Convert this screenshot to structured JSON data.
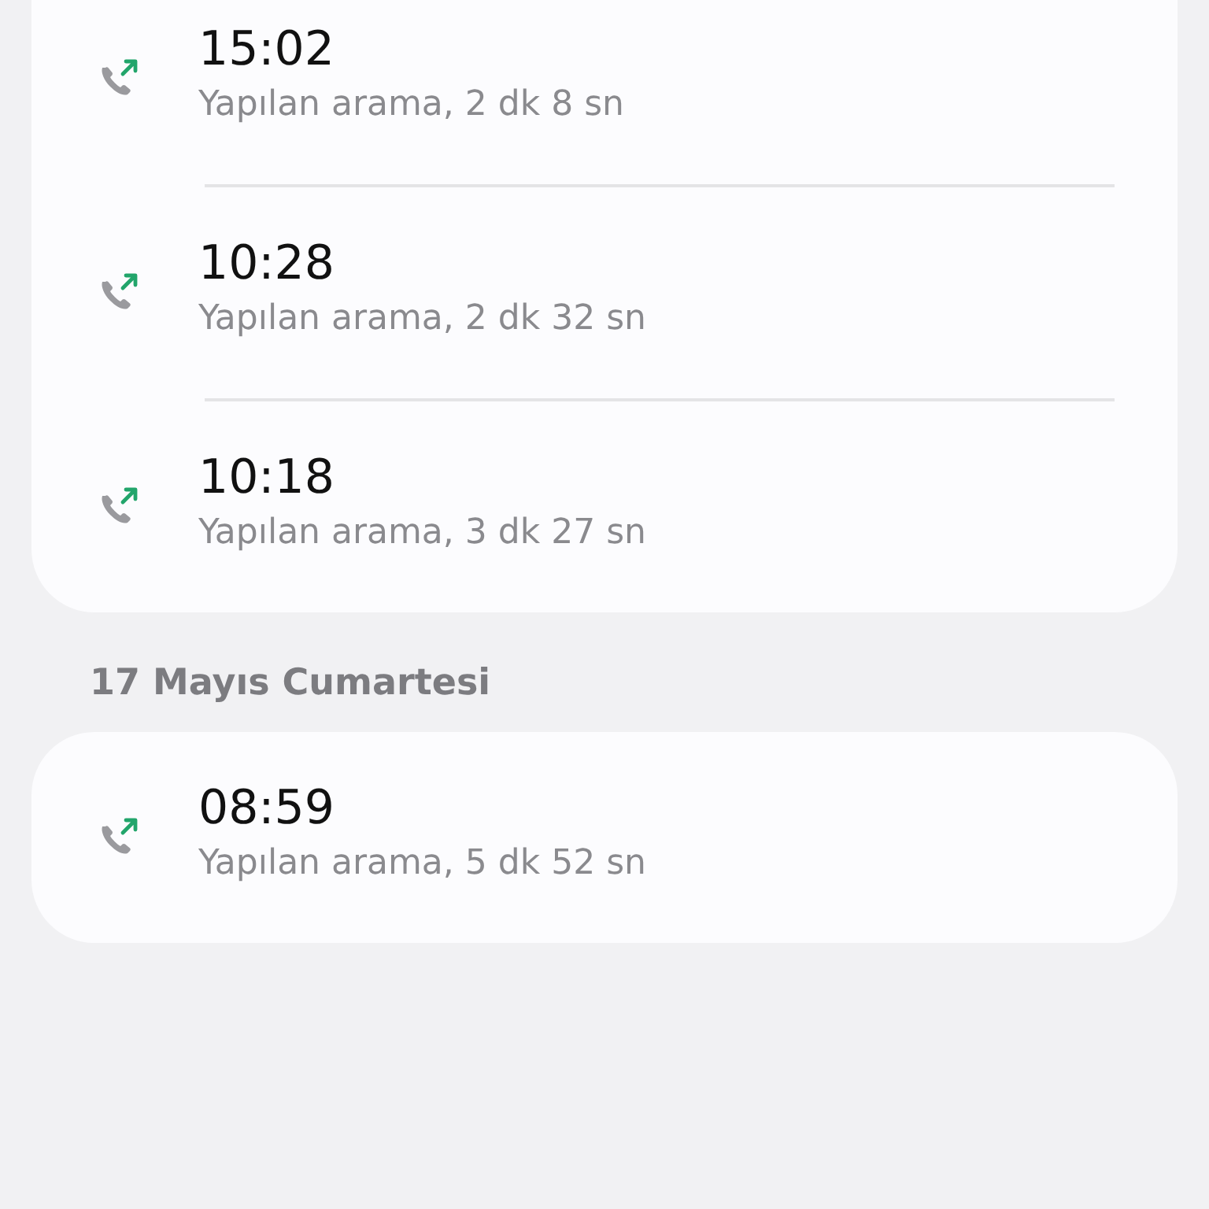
{
  "groups": [
    {
      "calls": [
        {
          "time": "15:02",
          "detail": "Yapılan arama, 2 dk 8 sn",
          "kind": "outgoing"
        },
        {
          "time": "10:28",
          "detail": "Yapılan arama, 2 dk 32 sn",
          "kind": "outgoing"
        },
        {
          "time": "10:18",
          "detail": "Yapılan arama, 3 dk 27 sn",
          "kind": "outgoing"
        }
      ]
    },
    {
      "date": "17 Mayıs Cumartesi",
      "calls": [
        {
          "time": "08:59",
          "detail": "Yapılan arama, 5 dk 52 sn",
          "kind": "outgoing"
        }
      ]
    }
  ]
}
